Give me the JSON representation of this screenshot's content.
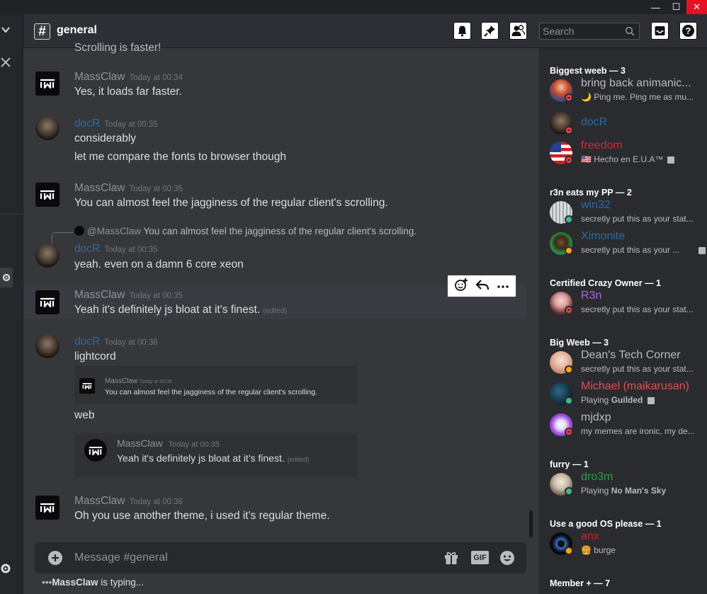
{
  "window": {
    "minimize": "—",
    "maximize": "☐",
    "close": "✕"
  },
  "header": {
    "hash": "#",
    "channel": "general",
    "search_placeholder": "Search"
  },
  "messages": [
    {
      "partial": "Scrolling is faster!"
    },
    {
      "user": "MassClaw",
      "time": "Today at 00:34",
      "lines": [
        "Yes, it loads far faster."
      ]
    },
    {
      "user": "docR",
      "time": "Today at 00:35",
      "lines": [
        "considerably",
        "let me compare the fonts to browser though"
      ]
    },
    {
      "user": "MassClaw",
      "time": "Today at 00:35",
      "lines": [
        "You can almost feel the jagginess of the regular client's scrolling."
      ]
    },
    {
      "reply_user": "@MassClaw",
      "reply_text": "You can almost feel the jagginess of the regular client's scrolling.",
      "user": "docR",
      "time": "Today at 00:35",
      "lines": [
        "yeah. even on a damn 6 core xeon"
      ]
    },
    {
      "user": "MassClaw",
      "time": "Today at 00:35",
      "lines": [
        "Yeah it's definitely js bloat at it's finest."
      ],
      "edited": "(edited)"
    },
    {
      "user": "docR",
      "time": "Today at 00:36",
      "lines": [
        "lightcord",
        "web"
      ],
      "embed1": {
        "user": "MassClaw",
        "time": "Today at 00:35",
        "text": "You can almost feel the jagginess of the regular client's scrolling."
      },
      "embed2": {
        "user": "MassClaw",
        "time": "Today at 00:35",
        "text": "Yeah it's definitely js bloat at it's finest.",
        "edited": "(edited)"
      }
    },
    {
      "user": "MassClaw",
      "time": "Today at 00:36",
      "lines": [
        "Oh you use another theme, i used it's regular theme."
      ]
    }
  ],
  "composer": {
    "placeholder": "Message #general",
    "gif": "GIF"
  },
  "typing": {
    "dots": "•••",
    "user": "MassClaw",
    "text": "is typing..."
  },
  "members": {
    "groups": [
      {
        "title": "Biggest weeb — 3",
        "items": [
          {
            "name": "bring back animanic...",
            "status": "🌙 Ping me. Ping me as mu...",
            "color": "#b9bbbe",
            "presence": "dnd"
          },
          {
            "name": "docR",
            "status": "",
            "color": "#2b6ca3",
            "presence": "dnd"
          },
          {
            "name": "freedom",
            "status": "🇺🇸 Hecho en E.U.A™",
            "color": "#e0242c",
            "presence": "dnd",
            "note": true
          }
        ]
      },
      {
        "title": "r3n eats my PP — 2",
        "items": [
          {
            "name": "win32",
            "status": "secretly put this as your stat...",
            "color": "#2b6ca3",
            "presence": "online"
          },
          {
            "name": "Ximonite",
            "status": "secretly put this as your ...",
            "color": "#2b6ca3",
            "presence": "idle",
            "note": true
          }
        ]
      },
      {
        "title": "Certified Crazy Owner — 1",
        "items": [
          {
            "name": "R3n",
            "status": "secretly put this as your stat...",
            "color": "#a96bdb",
            "presence": "dnd"
          }
        ]
      },
      {
        "title": "Big Weeb — 3",
        "items": [
          {
            "name": "Dean's Tech Corner",
            "status": "secretly put this as your stat...",
            "color": "#b9bbbe",
            "presence": "idle"
          },
          {
            "name": "Michael (maikarusan)",
            "status": "Playing Guilded",
            "color": "#e05050",
            "presence": "online",
            "note": true
          },
          {
            "name": "mjdxp",
            "status": "my memes are ironic, my de...",
            "color": "#b9bbbe",
            "presence": "dnd"
          }
        ]
      },
      {
        "title": "furry — 1",
        "items": [
          {
            "name": "dro3m",
            "status": "Playing No Man's Sky",
            "color": "#2e9e4a",
            "presence": "online"
          }
        ]
      },
      {
        "title": "Use a good OS please — 1",
        "items": [
          {
            "name": "anx",
            "status": "🍔 burge",
            "color": "#c1272d",
            "presence": "idle"
          }
        ]
      },
      {
        "title": "Member + — 7",
        "items": []
      }
    ]
  }
}
